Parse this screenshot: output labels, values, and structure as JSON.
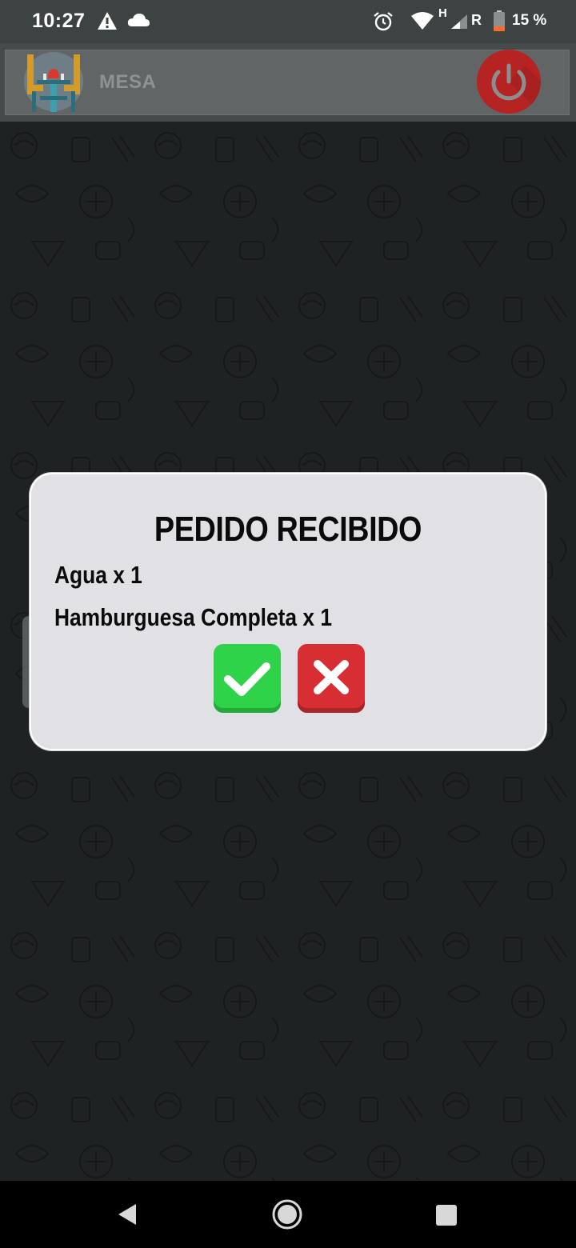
{
  "status_bar": {
    "time": "10:27",
    "network_type": "H",
    "roaming": "R",
    "battery": "15 %"
  },
  "app_bar": {
    "title": "MESA",
    "icons": [
      "restaurant-table-logo",
      "power-icon"
    ]
  },
  "dialog": {
    "title": "PEDIDO RECIBIDO",
    "items": [
      "Agua x 1",
      "Hamburguesa Completa x 1"
    ],
    "accept_icon": "check-icon",
    "cancel_icon": "close-icon"
  },
  "nav_bar": {
    "icons": [
      "back-icon",
      "home-icon",
      "recents-icon"
    ]
  },
  "colors": {
    "status_bar": "#3d4242",
    "app_bar": "#616565",
    "background": "#1f2222",
    "dialog_bg": "#e1e0e5",
    "accept": "#2fd34a",
    "cancel": "#d62e32",
    "power": "#b52323"
  }
}
